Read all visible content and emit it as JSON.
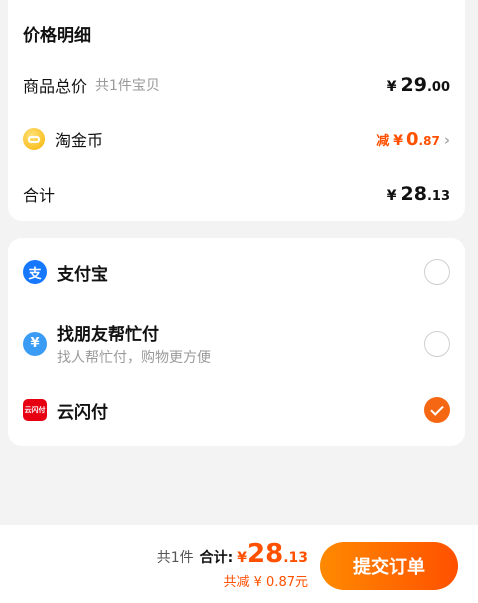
{
  "price_card": {
    "title": "价格明细",
    "goods_total": {
      "label": "商品总价",
      "note": "共1件宝贝",
      "yen": "¥",
      "int": "29",
      "dec": ".00"
    },
    "coins": {
      "label": "淘金币",
      "prefix": "减",
      "yen": "¥",
      "int": "0",
      "dec": ".87"
    },
    "total": {
      "label": "合计",
      "yen": "¥",
      "int": "28",
      "dec": ".13"
    }
  },
  "payment": {
    "methods": [
      {
        "name": "支付宝",
        "icon": "alipay-icon",
        "selected": false
      },
      {
        "name": "找朋友帮忙付",
        "sub": "找人帮忙付，购物更方便",
        "icon": "friend-pay-icon",
        "selected": false
      },
      {
        "name": "云闪付",
        "icon": "unionpay-icon",
        "icon_text": "云闪付",
        "selected": true
      }
    ]
  },
  "footer": {
    "count": "共1件",
    "total_label": "合计:",
    "yen": "¥",
    "int": "28",
    "dec": ".13",
    "discount": "共减 ¥ 0.87元",
    "submit": "提交订单"
  },
  "colors": {
    "accent": "#ff5000",
    "selected": "#f56712",
    "alipay": "#1677ff"
  }
}
